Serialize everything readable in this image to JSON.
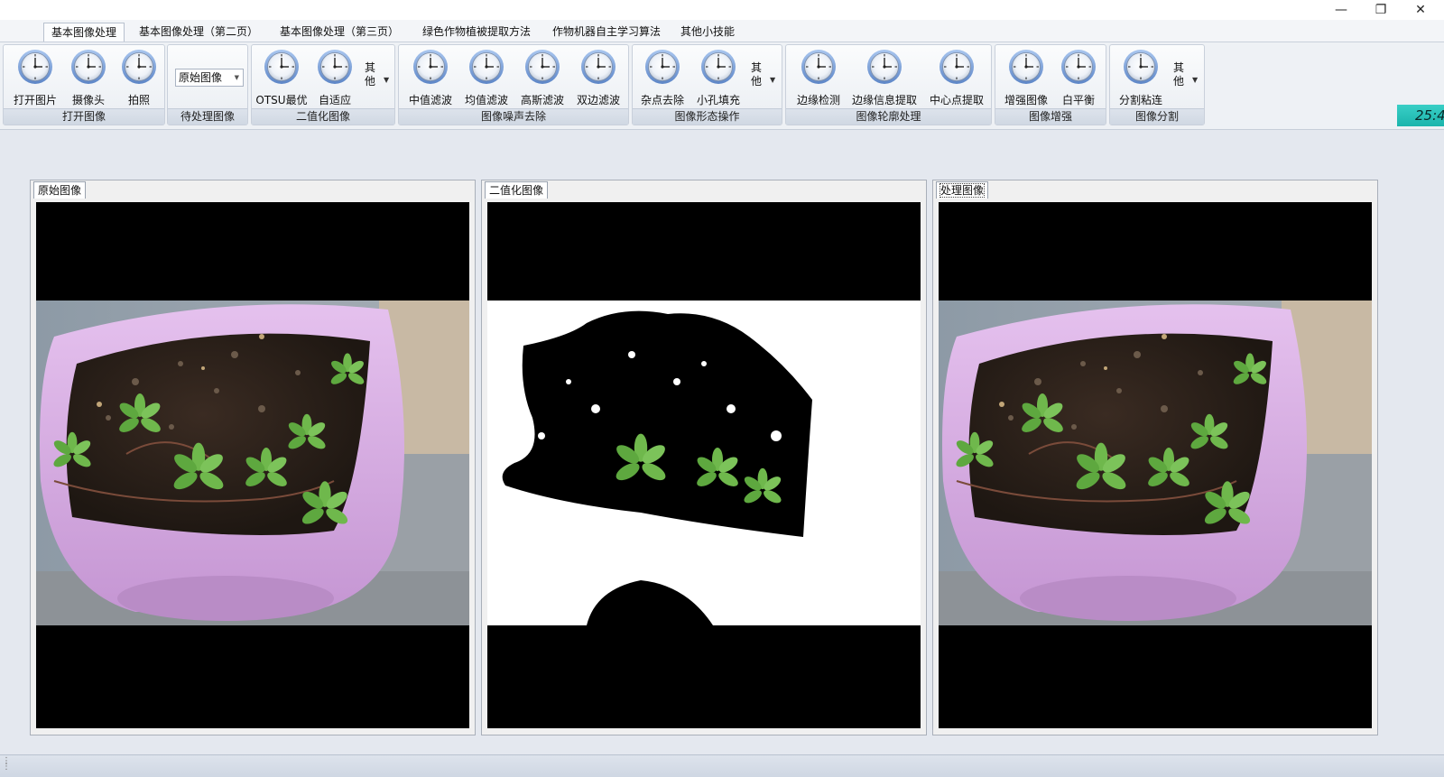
{
  "window": {
    "minimize": "—",
    "restore": "❐",
    "close": "✕"
  },
  "menu_tabs": [
    {
      "label": "基本图像处理"
    },
    {
      "label": "基本图像处理（第二页）"
    },
    {
      "label": "基本图像处理（第三页）"
    },
    {
      "label": "绿色作物植被提取方法"
    },
    {
      "label": "作物机器自主学习算法"
    },
    {
      "label": "其他小技能"
    }
  ],
  "mdi_controls": {
    "minimize": "–",
    "restore": "▫",
    "close": "✕"
  },
  "ribbon": {
    "open_group": {
      "caption": "打开图像",
      "buttons": [
        "打开图片",
        "摄像头",
        "拍照"
      ]
    },
    "pending_group": {
      "caption": "待处理图像",
      "combo_value": "原始图像"
    },
    "binary_group": {
      "caption": "二值化图像",
      "buttons": [
        "OTSU最优",
        "自适应"
      ],
      "other": "其他"
    },
    "denoise_group": {
      "caption": "图像噪声去除",
      "buttons": [
        "中值滤波",
        "均值滤波",
        "高斯滤波",
        "双边滤波"
      ]
    },
    "morph_group": {
      "caption": "图像形态操作",
      "buttons": [
        "杂点去除",
        "小孔填充"
      ],
      "other": "其他"
    },
    "contour_group": {
      "caption": "图像轮廓处理",
      "buttons": [
        "边缘检测",
        "边缘信息提取",
        "中心点提取"
      ]
    },
    "enhance_group": {
      "caption": "图像增强",
      "buttons": [
        "增强图像",
        "白平衡"
      ]
    },
    "segment_group": {
      "caption": "图像分割",
      "buttons": [
        "分割粘连"
      ],
      "other": "其他"
    }
  },
  "clock_display": "25:4",
  "panels": [
    {
      "tab": "原始图像"
    },
    {
      "tab": "二值化图像"
    },
    {
      "tab": "处理图像"
    }
  ]
}
